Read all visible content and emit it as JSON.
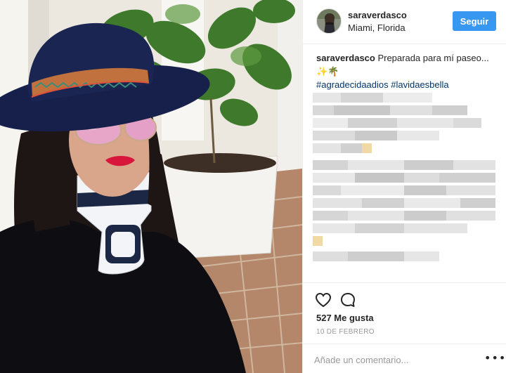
{
  "post": {
    "username": "saraverdasco",
    "location": "Miami, Florida",
    "follow_label": "Seguir",
    "caption_user": "saraverdasco",
    "caption_text": " Preparada para mí paseo...",
    "caption_emoji": "✨🌴",
    "hashtags": "#agradecidaadios #lavidaesbella",
    "likes": "527 Me gusta",
    "date": "10 DE FEBRERO",
    "comment_placeholder": "Añade un comentario...",
    "more_symbol": "•••"
  },
  "icons": {
    "like": "heart-icon",
    "comment": "comment-bubble-icon",
    "more": "more-options-icon"
  },
  "colors": {
    "follow_button": "#3897f0",
    "hashtag": "#003569",
    "text": "#262626",
    "muted": "#999999"
  }
}
